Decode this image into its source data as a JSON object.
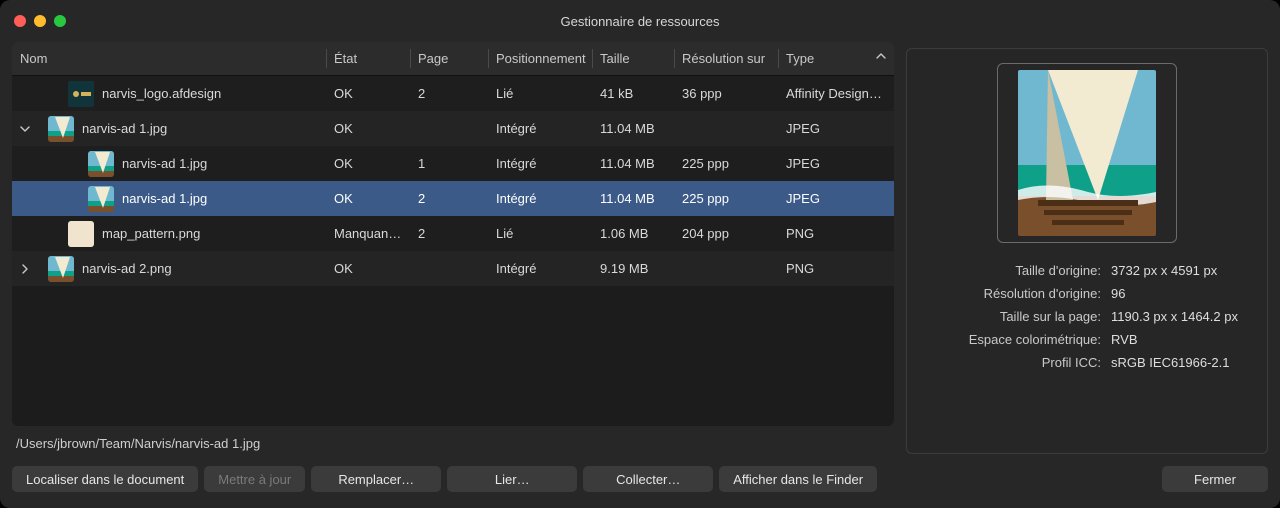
{
  "window": {
    "title": "Gestionnaire de ressources"
  },
  "columns": {
    "name": "Nom",
    "status": "État",
    "page": "Page",
    "position": "Positionnement",
    "size": "Taille",
    "resolution": "Résolution sur",
    "type": "Type"
  },
  "rows": [
    {
      "indent": 1,
      "disclosure": "",
      "thumb": "narvis-logo",
      "name": "narvis_logo.afdesign",
      "status": "OK",
      "page": "2",
      "position": "Lié",
      "size": "41 kB",
      "resolution": "36 ppp",
      "type": "Affinity Design…"
    },
    {
      "indent": 0,
      "disclosure": "down",
      "thumb": "boat",
      "name": "narvis-ad 1.jpg",
      "status": "OK",
      "page": "",
      "position": "Intégré",
      "size": "11.04 MB",
      "resolution": "",
      "type": "JPEG"
    },
    {
      "indent": 2,
      "disclosure": "",
      "thumb": "boat",
      "name": "narvis-ad 1.jpg",
      "status": "OK",
      "page": "1",
      "position": "Intégré",
      "size": "11.04 MB",
      "resolution": "225 ppp",
      "type": "JPEG",
      "selected": false
    },
    {
      "indent": 2,
      "disclosure": "",
      "thumb": "boat",
      "name": "narvis-ad 1.jpg",
      "status": "OK",
      "page": "2",
      "position": "Intégré",
      "size": "11.04 MB",
      "resolution": "225 ppp",
      "type": "JPEG",
      "selected": true
    },
    {
      "indent": 1,
      "disclosure": "",
      "thumb": "map",
      "name": "map_pattern.png",
      "status": "Manquantes",
      "page": "2",
      "position": "Lié",
      "size": "1.06 MB",
      "resolution": "204 ppp",
      "type": "PNG"
    },
    {
      "indent": 0,
      "disclosure": "right",
      "thumb": "boat2",
      "name": "narvis-ad 2.png",
      "status": "OK",
      "page": "",
      "position": "Intégré",
      "size": "9.19 MB",
      "resolution": "",
      "type": "PNG"
    }
  ],
  "path": "/Users/jbrown/Team/Narvis/narvis-ad 1.jpg",
  "details": {
    "labels": {
      "orig_size": "Taille d'origine:",
      "orig_res": "Résolution d'origine:",
      "page_size": "Taille sur la page:",
      "color_space": "Espace colorimétrique:",
      "icc": "Profil ICC:"
    },
    "values": {
      "orig_size": "3732 px x 4591 px",
      "orig_res": "96",
      "page_size": "1190.3 px x 1464.2 px",
      "color_space": "RVB",
      "icc": "sRGB IEC61966-2.1"
    }
  },
  "buttons": {
    "locate": "Localiser dans le document",
    "update": "Mettre à jour",
    "replace": "Remplacer…",
    "link": "Lier…",
    "collect": "Collecter…",
    "show_in_finder": "Afficher dans le Finder",
    "close": "Fermer"
  }
}
